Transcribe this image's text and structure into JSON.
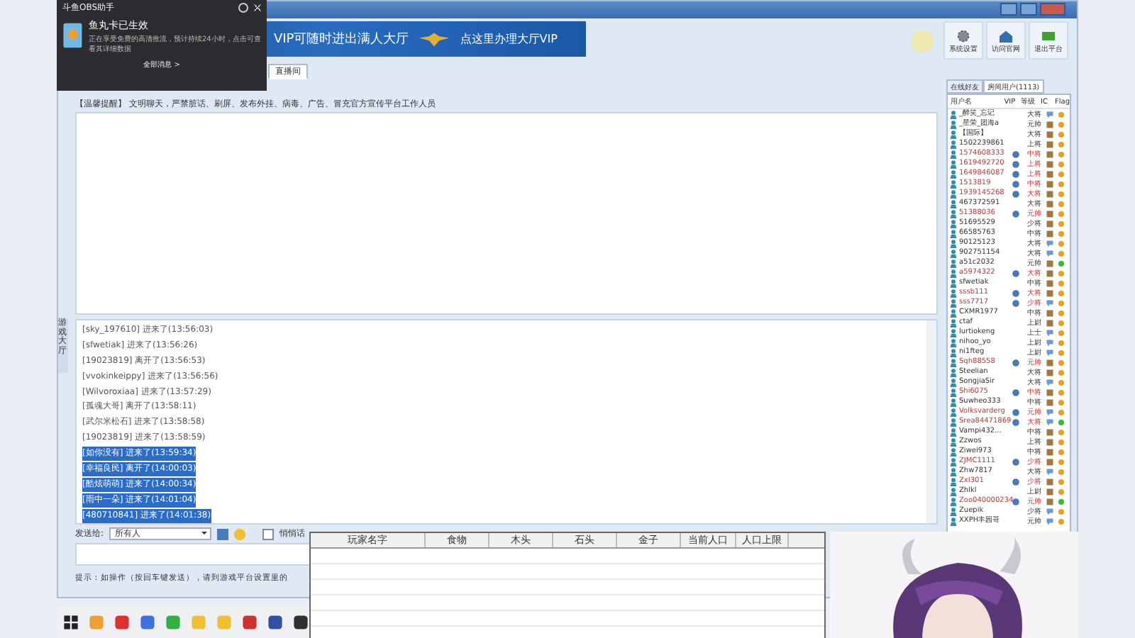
{
  "banner": {
    "headline": "VIP可随时进出满人大厅",
    "cta": "点这里办理大厅VIP"
  },
  "toolbar": [
    {
      "label": "系统设置",
      "kind": "gear"
    },
    {
      "label": "访问官网",
      "kind": "house"
    },
    {
      "label": "退出平台",
      "kind": "exit"
    }
  ],
  "tabs": [
    {
      "label": "直播间",
      "selected": true
    }
  ],
  "notice": "【温馨提醒】 文明聊天，严禁脏话、刷屏、发布外挂、病毒、广告、冒充官方宣传平台工作人员",
  "side_tab": "游戏大厅",
  "messages": [
    {
      "text": "[sky_197610] 进来了(13:56:03)",
      "selected": false
    },
    {
      "text": "[sfwetiak] 进来了(13:56:26)",
      "selected": false
    },
    {
      "text": "[19023819] 离开了(13:56:53)",
      "selected": false
    },
    {
      "text": "[vvokinkeippy] 进来了(13:56:56)",
      "selected": false
    },
    {
      "text": "[Wilvoroxiaa] 进来了(13:57:29)",
      "selected": false
    },
    {
      "text": "[孤魂大哥] 离开了(13:58:11)",
      "selected": false
    },
    {
      "text": "[武尔米松石] 进来了(13:58:58)",
      "selected": false
    },
    {
      "text": "[19023819] 进来了(13:58:59)",
      "selected": false
    },
    {
      "text": "[如你没有] 进来了(13:59:34)",
      "selected": true
    },
    {
      "text": "[幸福良民] 离开了(14:00:03)",
      "selected": true
    },
    {
      "text": "[酷炫萌萌] 进来了(14:00:34)",
      "selected": true
    },
    {
      "text": "[雨中一朵] 进来了(14:01:04)",
      "selected": true
    },
    {
      "text": "[480710841] 进来了(14:01:38)",
      "selected": true
    }
  ],
  "send": {
    "label": "发送给:",
    "recipient": "所有人",
    "whisper": {
      "label": "悄悄话",
      "checked": false
    }
  },
  "tip": "提示：如操作（按回车键发送），请到游戏平台设置里的",
  "user_panel": {
    "tabs": [
      {
        "label": "在线好友",
        "selected": false
      },
      {
        "label": "房间用户(1113)",
        "selected": true
      }
    ],
    "columns": [
      "用户名",
      "VIP",
      "等级",
      "IC",
      "Flag"
    ],
    "users": [
      {
        "name": "_醉笑_忘记",
        "vip": false,
        "rank": "大将",
        "kind": "speech",
        "color": "#e8a020"
      },
      {
        "name": "_星荣_团海a",
        "vip": false,
        "rank": "元帅",
        "kind": "box",
        "color": "#e8a020"
      },
      {
        "name": "【国际】",
        "vip": false,
        "rank": "大将",
        "kind": "box",
        "color": "#e8a020"
      },
      {
        "name": "1502239861",
        "vip": false,
        "rank": "上将",
        "kind": "box",
        "color": "#e8a020"
      },
      {
        "name": "1574608333",
        "vip": true,
        "rank": "中将",
        "kind": "box",
        "color": "#e8a020"
      },
      {
        "name": "1619492720",
        "vip": true,
        "rank": "上将",
        "kind": "box",
        "color": "#e8a020"
      },
      {
        "name": "1649846087",
        "vip": true,
        "rank": "上将",
        "kind": "box",
        "color": "#e8a020"
      },
      {
        "name": "1513819",
        "vip": true,
        "rank": "中将",
        "kind": "box",
        "color": "#e8a020"
      },
      {
        "name": "1939145268",
        "vip": true,
        "rank": "大将",
        "kind": "box",
        "color": "#e8a020"
      },
      {
        "name": "467372591",
        "vip": false,
        "rank": "大将",
        "kind": "box",
        "color": "#e8a020"
      },
      {
        "name": "51388036",
        "vip": true,
        "rank": "元帅",
        "kind": "box",
        "color": "#e8a020"
      },
      {
        "name": "51695529",
        "vip": false,
        "rank": "少将",
        "kind": "box",
        "color": "#e8a020"
      },
      {
        "name": "66585763",
        "vip": false,
        "rank": "中将",
        "kind": "box",
        "color": "#e8a020"
      },
      {
        "name": "90125123",
        "vip": false,
        "rank": "大将",
        "kind": "speech",
        "color": "#e8a020"
      },
      {
        "name": "902751154",
        "vip": false,
        "rank": "大将",
        "kind": "speech",
        "color": "#e8a020"
      },
      {
        "name": "a51c2032",
        "vip": false,
        "rank": "元帅",
        "kind": "box",
        "color": "#30c030"
      },
      {
        "name": "a5974322",
        "vip": true,
        "rank": "大将",
        "kind": "box",
        "color": "#e8a020"
      },
      {
        "name": "sfwetiak",
        "vip": false,
        "rank": "中将",
        "kind": "box",
        "color": "#e8a020"
      },
      {
        "name": "sssb111",
        "vip": true,
        "rank": "大将",
        "kind": "box",
        "color": "#e8a020"
      },
      {
        "name": "sss7717",
        "vip": true,
        "rank": "少将",
        "kind": "speech",
        "color": "#e8a020"
      },
      {
        "name": "CXMR1977",
        "vip": false,
        "rank": "中将",
        "kind": "box",
        "color": "#e8a020"
      },
      {
        "name": "ctaf",
        "vip": false,
        "rank": "上尉",
        "kind": "box",
        "color": "#e8a020"
      },
      {
        "name": "lurtiokeng",
        "vip": false,
        "rank": "上士",
        "kind": "speech",
        "color": "#e8a020"
      },
      {
        "name": "nihoo_yo",
        "vip": false,
        "rank": "上尉",
        "kind": "speech",
        "color": "#e8a020"
      },
      {
        "name": "ni1fteg",
        "vip": false,
        "rank": "上尉",
        "kind": "speech",
        "color": "#e8a020"
      },
      {
        "name": "Sqh88558",
        "vip": true,
        "rank": "元帅",
        "kind": "box",
        "color": "#e8a020"
      },
      {
        "name": "Steelian",
        "vip": false,
        "rank": "大将",
        "kind": "box",
        "color": "#e8a020"
      },
      {
        "name": "SongjiaSir",
        "vip": false,
        "rank": "大将",
        "kind": "speech",
        "color": "#e8a020"
      },
      {
        "name": "Shi6075",
        "vip": true,
        "rank": "中将",
        "kind": "box",
        "color": "#e8a020"
      },
      {
        "name": "Suwheo333",
        "vip": false,
        "rank": "中将",
        "kind": "box",
        "color": "#e8a020"
      },
      {
        "name": "Volksvarderg",
        "vip": true,
        "rank": "元帅",
        "kind": "speech",
        "color": "#e8a020"
      },
      {
        "name": "Srea84471869",
        "vip": true,
        "rank": "大将",
        "kind": "speech",
        "color": "#30c030"
      },
      {
        "name": "Vampi432...",
        "vip": false,
        "rank": "中将",
        "kind": "box",
        "color": "#e8a020"
      },
      {
        "name": "Zzwos",
        "vip": false,
        "rank": "上将",
        "kind": "box",
        "color": "#e8a020"
      },
      {
        "name": "Ziwei973",
        "vip": false,
        "rank": "中将",
        "kind": "box",
        "color": "#e8a020"
      },
      {
        "name": "ZJMC1111",
        "vip": true,
        "rank": "少将",
        "kind": "box",
        "color": "#e8a020"
      },
      {
        "name": "Zhw7817",
        "vip": false,
        "rank": "大将",
        "kind": "speech",
        "color": "#e8a020"
      },
      {
        "name": "ZxI301",
        "vip": true,
        "rank": "少将",
        "kind": "box",
        "color": "#e8a020"
      },
      {
        "name": "Zhlkl",
        "vip": false,
        "rank": "上尉",
        "kind": "box",
        "color": "#e8a020"
      },
      {
        "name": "Zoo040000234",
        "vip": true,
        "rank": "元帅",
        "kind": "box",
        "color": "#30c030"
      },
      {
        "name": "Zuepik",
        "vip": false,
        "rank": "少将",
        "kind": "speech",
        "color": "#e8a020"
      },
      {
        "name": "XXPH丰园哥",
        "vip": false,
        "rank": "元帅",
        "kind": "speech",
        "color": "#e8a020"
      }
    ]
  },
  "popup": {
    "title": "斗鱼OBS助手",
    "heading": "鱼丸卡已生效",
    "body": "正在享受免费的高清推流，预计持续24小时，点击可查看其详细数据",
    "link": "全部消息 >"
  },
  "resource_table": {
    "columns": [
      "玩家名字",
      "食物",
      "木头",
      "石头",
      "金子",
      "当前人口",
      "人口上限"
    ]
  }
}
